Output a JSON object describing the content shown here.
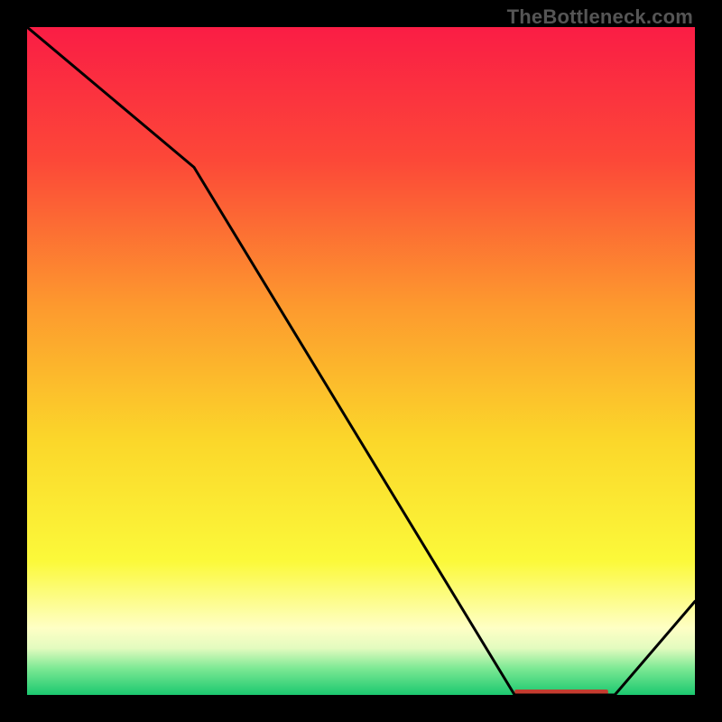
{
  "watermark": "TheBottleneck.com",
  "chart_data": {
    "type": "line",
    "title": "",
    "xlabel": "",
    "ylabel": "",
    "xlim": [
      0,
      100
    ],
    "ylim": [
      0,
      100
    ],
    "grid": false,
    "legend": false,
    "series": [
      {
        "name": "curve",
        "x": [
          0,
          25,
          73,
          82,
          88,
          100
        ],
        "values": [
          100,
          79,
          0,
          0,
          0,
          14
        ]
      }
    ],
    "annotation_bar": {
      "x_start": 73,
      "x_end": 87,
      "y": 0,
      "color": "#c43c2f"
    },
    "background_gradient": {
      "stops": [
        {
          "pos": 0.0,
          "color": "#fa1d45"
        },
        {
          "pos": 0.2,
          "color": "#fc4838"
        },
        {
          "pos": 0.42,
          "color": "#fd9a2e"
        },
        {
          "pos": 0.62,
          "color": "#fbd72a"
        },
        {
          "pos": 0.8,
          "color": "#fbf93a"
        },
        {
          "pos": 0.9,
          "color": "#feffc5"
        },
        {
          "pos": 0.93,
          "color": "#e3fbbf"
        },
        {
          "pos": 0.96,
          "color": "#7de994"
        },
        {
          "pos": 1.0,
          "color": "#1bc86f"
        }
      ]
    }
  }
}
